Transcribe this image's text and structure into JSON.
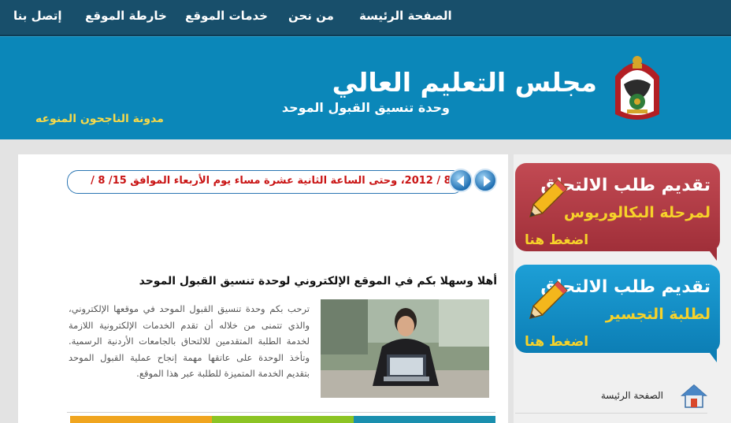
{
  "nav": {
    "home": "الصفحة الرئيسة",
    "about": "من نحن",
    "services": "خدمات الموقع",
    "sitemap": "خارطة الموقع",
    "contact": "إتصل بنا"
  },
  "header": {
    "title": "مجلس التعليم العالي",
    "subtitle": "وحدة تنسيق القبول الموحد",
    "blog_link": "مدونة الناجحون المنوعه"
  },
  "ticker": {
    "text": "/ 8 / 2012، وحتى الساعة الثانية عشرة مساء يوم الأربعاء الموافق 15/ 8 /"
  },
  "welcome": {
    "title": "أهلا وسهلا بكم في الموقع الإلكتروني لوحدة تنسيق القبول الموحد",
    "body": "ترحب بكم وحدة تنسيق القبول الموحد في موقعها الإلكتروني، والذي تتمنى من خلاله أن تقدم الخدمات الإلكترونية اللازمة لخدمة الطلبة المتقدمين للالتحاق بالجامعات الأردنية الرسمية. وتأخذ الوحدة على عاتقها مهمة إنجاح عملية القبول الموحد بتقديم الخدمة المتميزة للطلبة عبر هذا الموقع."
  },
  "promos": [
    {
      "title": "تقديم طلب الالتحاق",
      "subtitle": "لمرحلة البكالوريوس",
      "cta": "اضغط هنا",
      "color": "#b23a44"
    },
    {
      "title": "تقديم طلب الالتحاق",
      "subtitle": "لطلبة التجسير",
      "cta": "اضغط هنا",
      "color": "#0f8bc5"
    }
  ],
  "side_menu": {
    "home": "الصفحة الرئيسة"
  },
  "colors": {
    "nav_bg": "#184f6b",
    "header_bg": "#0b87b9",
    "accent_yellow": "#f6d22a",
    "ticker_red": "#c91414"
  },
  "icons": {
    "prev": "arrow-left-icon",
    "next": "arrow-right-icon",
    "pencil": "pencil-icon",
    "home": "house-icon"
  }
}
